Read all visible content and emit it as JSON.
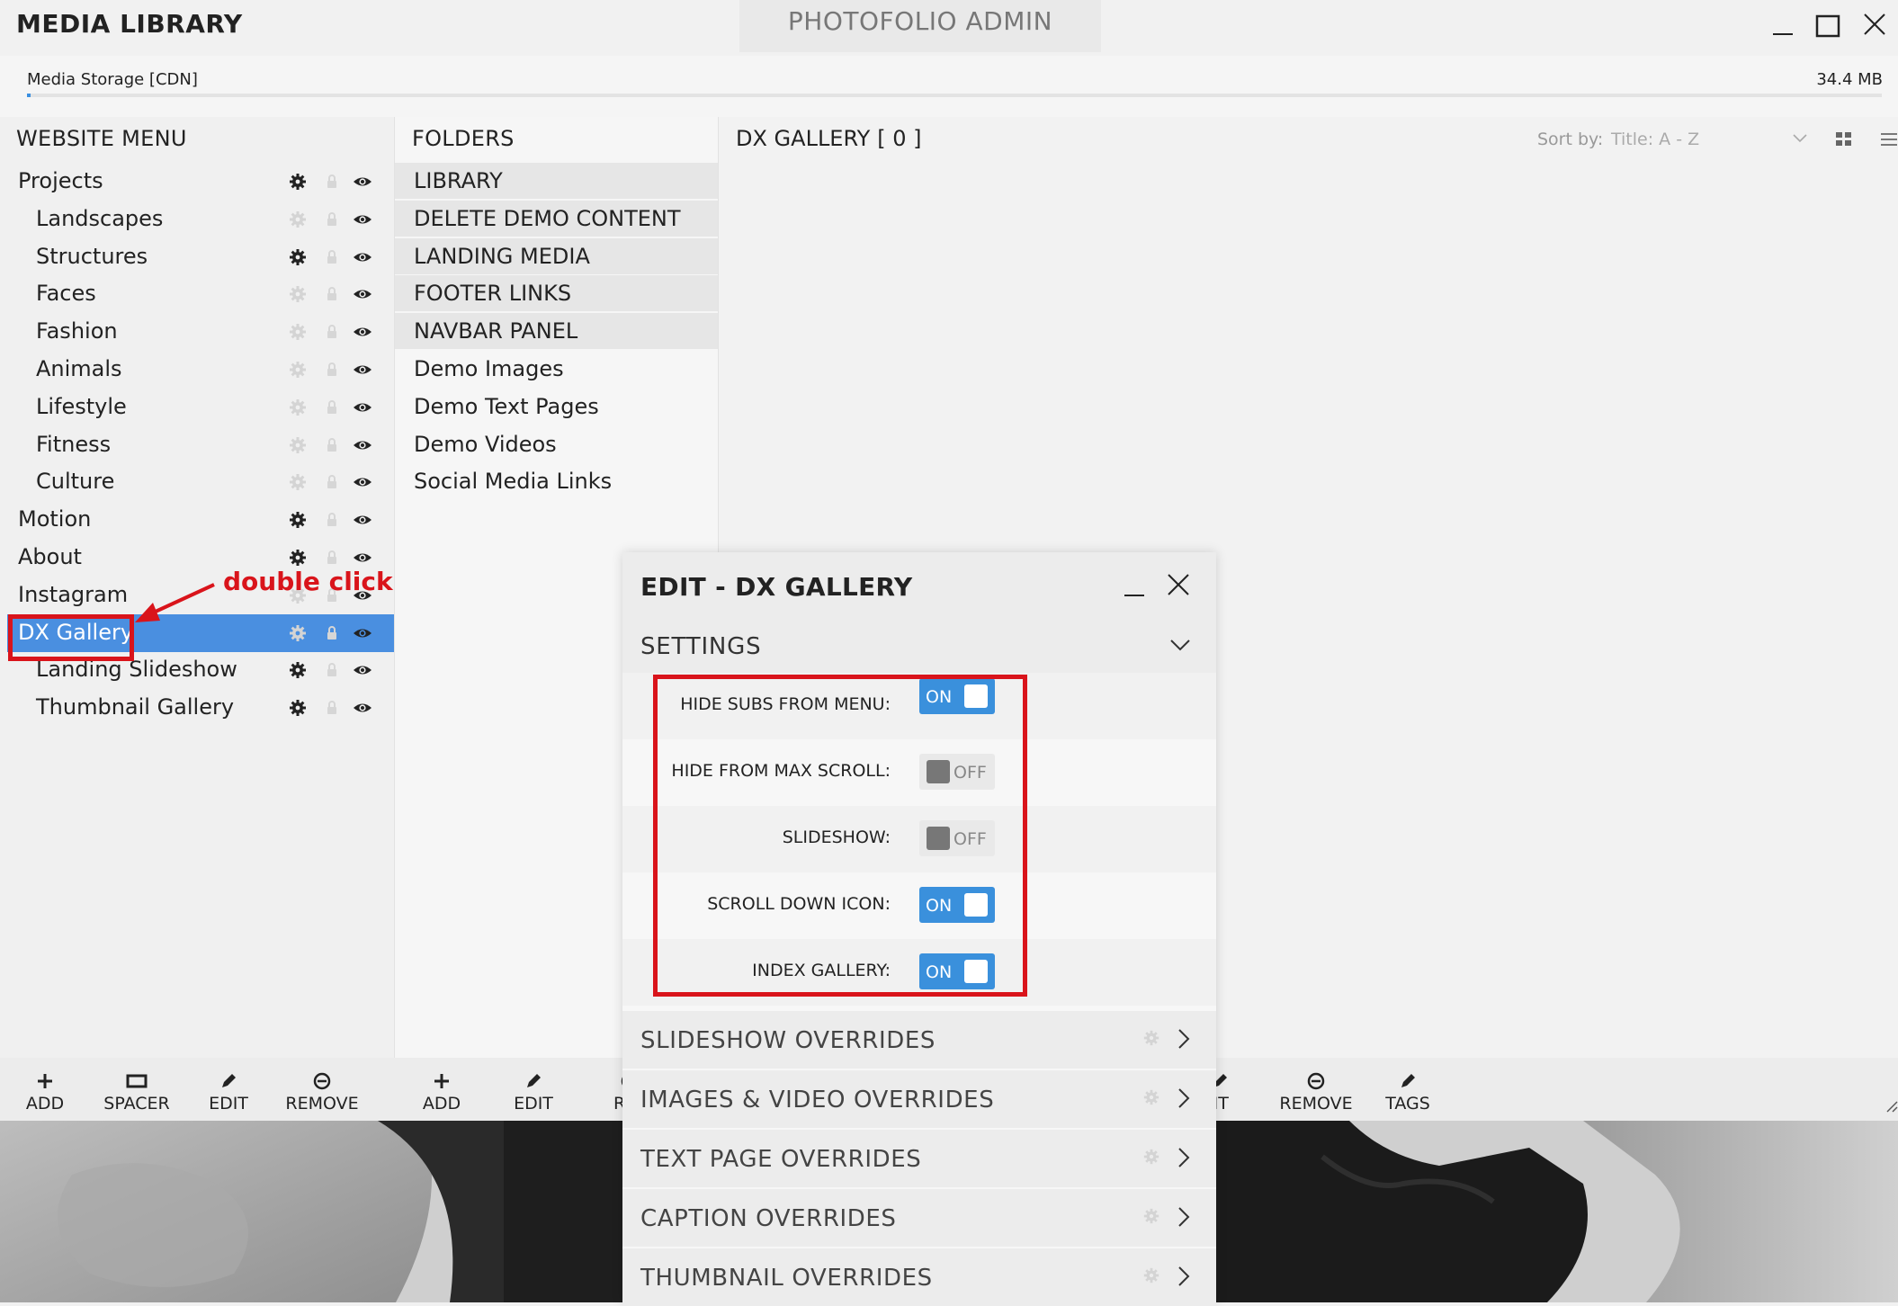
{
  "window": {
    "app_title": "MEDIA LIBRARY",
    "center_title": "PHOTOFOLIO ADMIN"
  },
  "storage": {
    "label": "Media Storage [CDN]",
    "size": "34.4 MB",
    "usage_fraction": 0.002
  },
  "menu_panel": {
    "title": "WEBSITE MENU",
    "items": [
      {
        "label": "Projects",
        "indent": 0,
        "selected": false
      },
      {
        "label": "Landscapes",
        "indent": 1,
        "selected": false
      },
      {
        "label": "Structures",
        "indent": 1,
        "selected": false
      },
      {
        "label": "Faces",
        "indent": 1,
        "selected": false
      },
      {
        "label": "Fashion",
        "indent": 1,
        "selected": false
      },
      {
        "label": "Animals",
        "indent": 1,
        "selected": false
      },
      {
        "label": "Lifestyle",
        "indent": 1,
        "selected": false
      },
      {
        "label": "Fitness",
        "indent": 1,
        "selected": false
      },
      {
        "label": "Culture",
        "indent": 1,
        "selected": false
      },
      {
        "label": "Motion",
        "indent": 0,
        "selected": false
      },
      {
        "label": "About",
        "indent": 0,
        "selected": false
      },
      {
        "label": "Instagram",
        "indent": 0,
        "selected": false
      },
      {
        "label": "DX Gallery",
        "indent": 0,
        "selected": true
      },
      {
        "label": "Landing Slideshow",
        "indent": 1,
        "selected": false
      },
      {
        "label": "Thumbnail Gallery",
        "indent": 1,
        "selected": false
      }
    ],
    "toolbar": [
      "ADD",
      "SPACER",
      "EDIT",
      "REMOVE"
    ]
  },
  "folders_panel": {
    "title": "FOLDERS",
    "items": [
      {
        "label": "LIBRARY",
        "system": true
      },
      {
        "label": "DELETE DEMO CONTENT",
        "system": true
      },
      {
        "label": "LANDING MEDIA",
        "system": true
      },
      {
        "label": "FOOTER LINKS",
        "system": true
      },
      {
        "label": "NAVBAR PANEL",
        "system": true
      },
      {
        "label": "Demo Images",
        "system": false
      },
      {
        "label": "Demo Text Pages",
        "system": false
      },
      {
        "label": "Demo Videos",
        "system": false
      },
      {
        "label": "Social Media Links",
        "system": false
      }
    ],
    "toolbar": [
      "ADD",
      "EDIT",
      "REM"
    ]
  },
  "gallery_panel": {
    "title": "DX GALLERY",
    "count": "[ 0 ]",
    "sort_label": "Sort by:",
    "sort_value": "Title: A - Z",
    "toolbar": [
      "DIT",
      "REMOVE",
      "TAGS"
    ]
  },
  "annotation": {
    "text": "double click",
    "color": "#d9141b"
  },
  "edit_modal": {
    "title": "EDIT - DX GALLERY",
    "settings_title": "SETTINGS",
    "settings": [
      {
        "label": "HIDE SUBS FROM MENU:",
        "state": "ON"
      },
      {
        "label": "HIDE FROM MAX SCROLL:",
        "state": "OFF"
      },
      {
        "label": "SLIDESHOW:",
        "state": "OFF"
      },
      {
        "label": "SCROLL DOWN ICON:",
        "state": "ON"
      },
      {
        "label": "INDEX GALLERY:",
        "state": "ON"
      }
    ],
    "overrides": [
      "SLIDESHOW OVERRIDES",
      "IMAGES & VIDEO OVERRIDES",
      "TEXT PAGE OVERRIDES",
      "CAPTION OVERRIDES",
      "THUMBNAIL OVERRIDES"
    ]
  },
  "colors": {
    "accent": "#4a8fe0",
    "toggle_on": "#3a90dc",
    "annotation_red": "#d9141b"
  }
}
